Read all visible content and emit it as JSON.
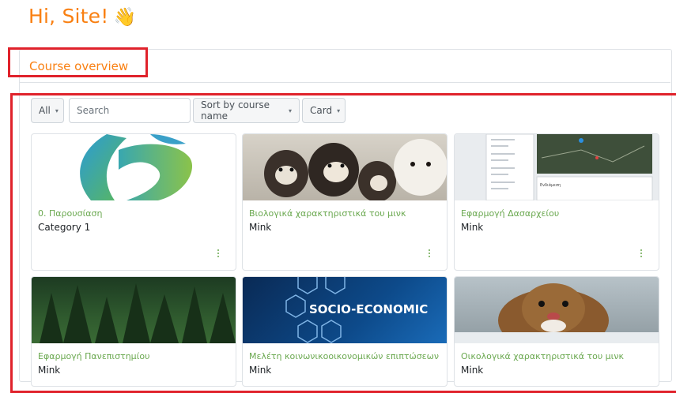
{
  "greeting": {
    "text": "Hi, Site!",
    "emoji": "👋"
  },
  "block": {
    "title": "Course overview"
  },
  "controls": {
    "filter": "All",
    "search_placeholder": "Search",
    "sort": "Sort by course name",
    "view": "Card"
  },
  "courses": [
    {
      "category": "0. Παρουσίαση",
      "subtitle": "Category 1"
    },
    {
      "category": "Βιολογικά χαρακτηριστικά του μινκ",
      "subtitle": "Mink"
    },
    {
      "category": "Εφαρμογή Δασαρχείου",
      "subtitle": "Mink"
    },
    {
      "category": "Εφαρμογή Πανεπιστημίου",
      "subtitle": "Mink"
    },
    {
      "category": "Μελέτη κοινωνικοοικονομικών επιπτώσεων",
      "subtitle": "Mink"
    },
    {
      "category": "Οικολογικά χαρακτηριστικά του μινκ",
      "subtitle": "Mink"
    }
  ],
  "image_texts": {
    "socio": "SOCIO-ECONOMIC",
    "map_label": "Ενδιάμεση"
  },
  "colors": {
    "accent": "#f98012",
    "category": "#6aa84f",
    "highlight": "#e0222b"
  }
}
